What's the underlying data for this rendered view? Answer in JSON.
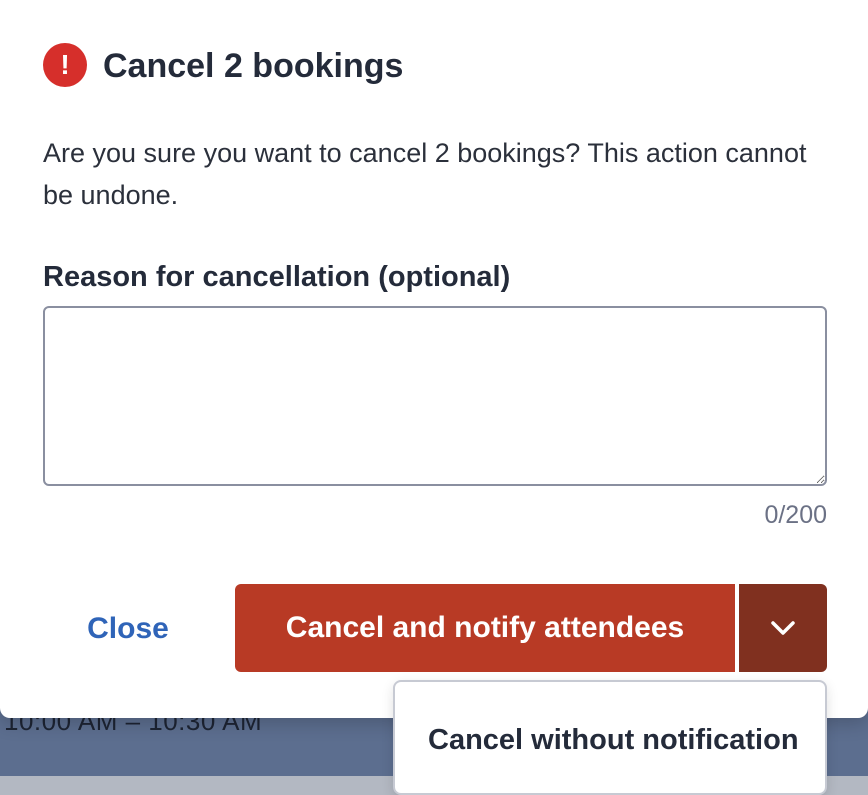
{
  "backdrop": {
    "time_range": "10:00 AM – 10:30 AM"
  },
  "dialog": {
    "icon": "alert-circle-icon",
    "title": "Cancel 2 bookings",
    "message": "Are you sure you want to cancel 2 bookings? This action cannot be undone.",
    "reason": {
      "label": "Reason for cancellation (optional)",
      "value": "",
      "placeholder": "",
      "counter": "0/200"
    },
    "actions": {
      "close_label": "Close",
      "primary_label": "Cancel and notify attendees",
      "toggle_icon": "chevron-down-icon",
      "menu_items": [
        "Cancel without notification"
      ]
    }
  },
  "colors": {
    "alert": "#d62f2b",
    "primary": "#b83a25",
    "primary_dark": "#80301f",
    "link": "#2f64b8"
  }
}
